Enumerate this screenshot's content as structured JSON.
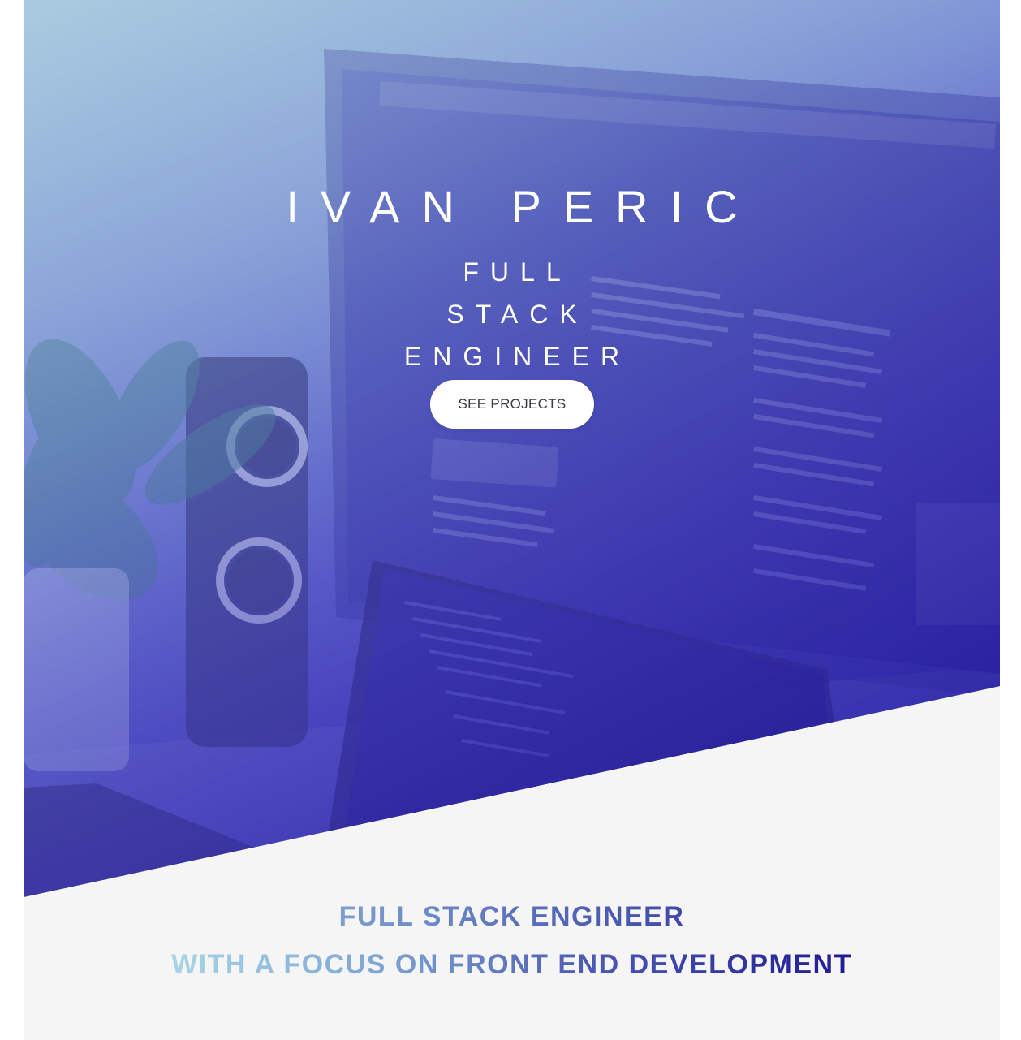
{
  "hero": {
    "name": "IVAN PERIC",
    "role": "FULL STACK ENGINEER",
    "cta_label": "SEE PROJECTS"
  },
  "tagline": {
    "line1": "FULL STACK ENGINEER",
    "line2": "WITH A FOCUS ON FRONT END DEVELOPMENT"
  },
  "colors": {
    "hero_gradient_start": "#a9c9dd",
    "hero_gradient_end": "#241c9a",
    "background": "#f5f5f5",
    "cta_background": "#ffffff",
    "cta_text": "#3a3a4a"
  }
}
